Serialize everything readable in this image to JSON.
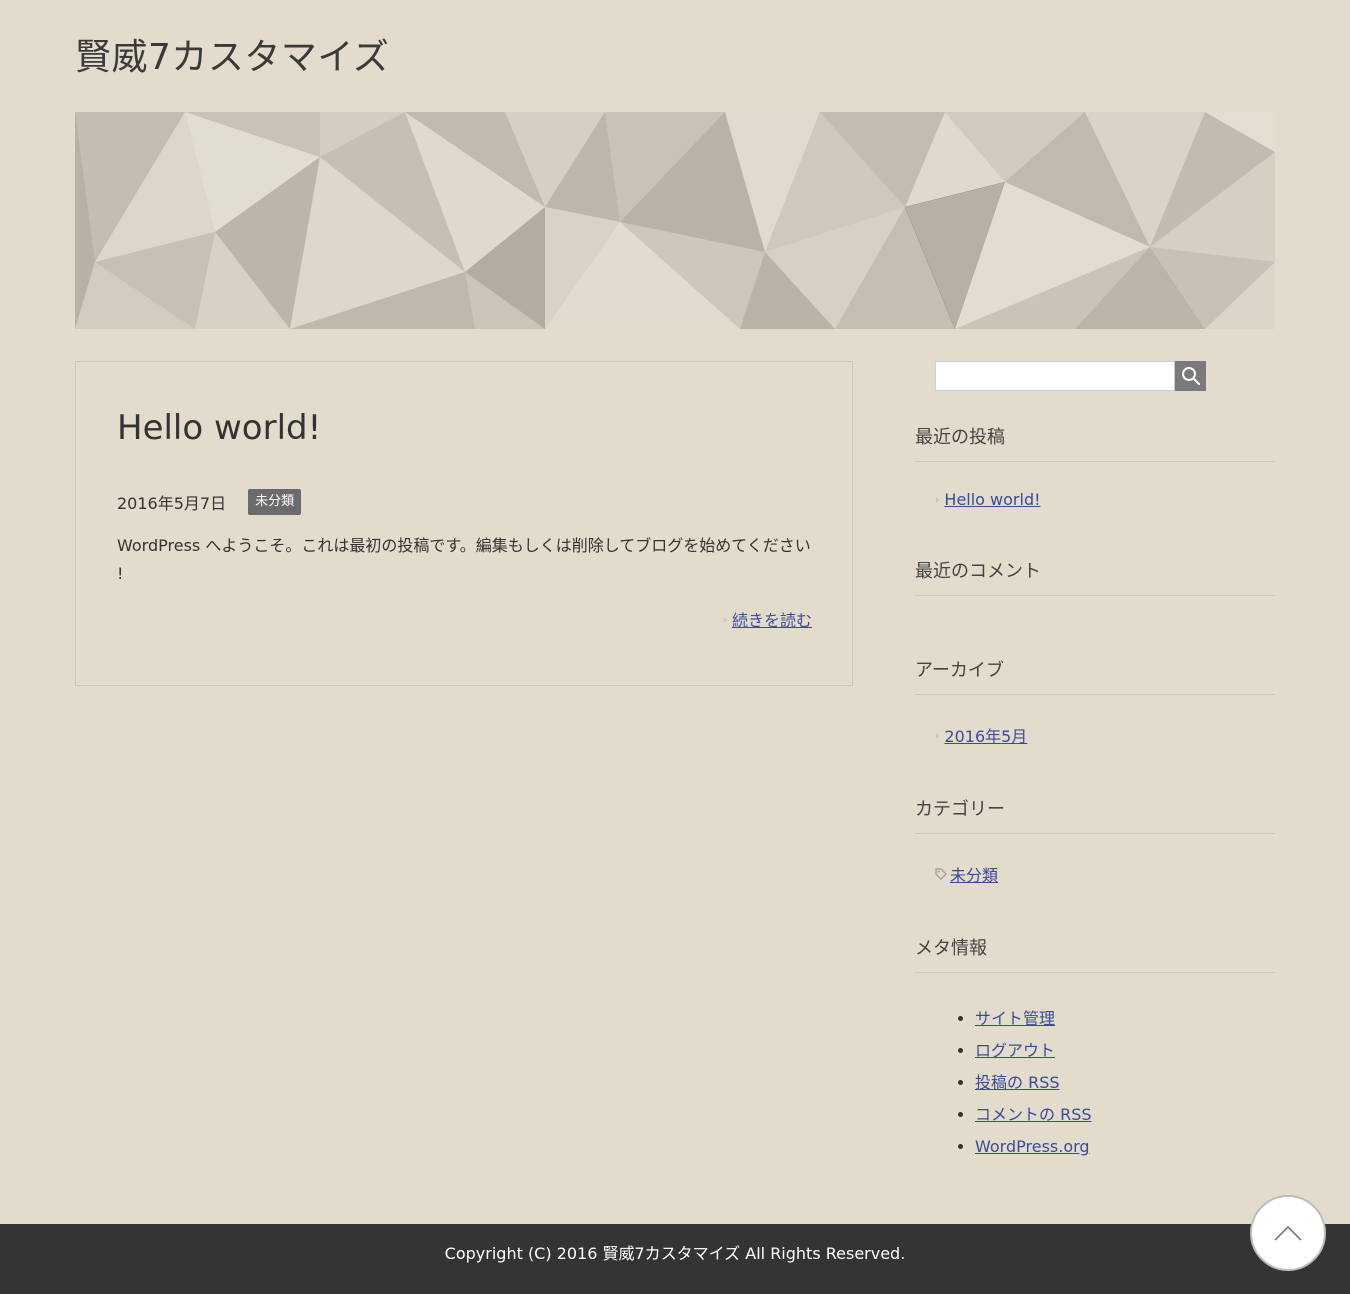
{
  "site": {
    "title": "賢威7カスタマイズ"
  },
  "post": {
    "title": "Hello world!",
    "date": "2016年5月7日",
    "category": "未分類",
    "excerpt": "WordPress へようこそ。これは最初の投稿です。編集もしくは削除してブログを始めてください !",
    "read_more": "続きを読む"
  },
  "search": {
    "placeholder": ""
  },
  "sidebar": {
    "recent_posts": {
      "title": "最近の投稿",
      "items": [
        "Hello world!"
      ]
    },
    "recent_comments": {
      "title": "最近のコメント"
    },
    "archives": {
      "title": "アーカイブ",
      "items": [
        "2016年5月"
      ]
    },
    "categories": {
      "title": "カテゴリー",
      "items": [
        "未分類"
      ]
    },
    "meta": {
      "title": "メタ情報",
      "items": [
        "サイト管理",
        "ログアウト",
        "投稿の RSS",
        "コメントの RSS",
        "WordPress.org"
      ]
    }
  },
  "footer": {
    "copyright": "Copyright (C) 2016 賢威7カスタマイズ All Rights Reserved."
  },
  "icons": {
    "search": "search-icon",
    "to_top": "chevron-up-icon",
    "bullet": "chevron-right-icon",
    "tag": "tag-icon"
  }
}
